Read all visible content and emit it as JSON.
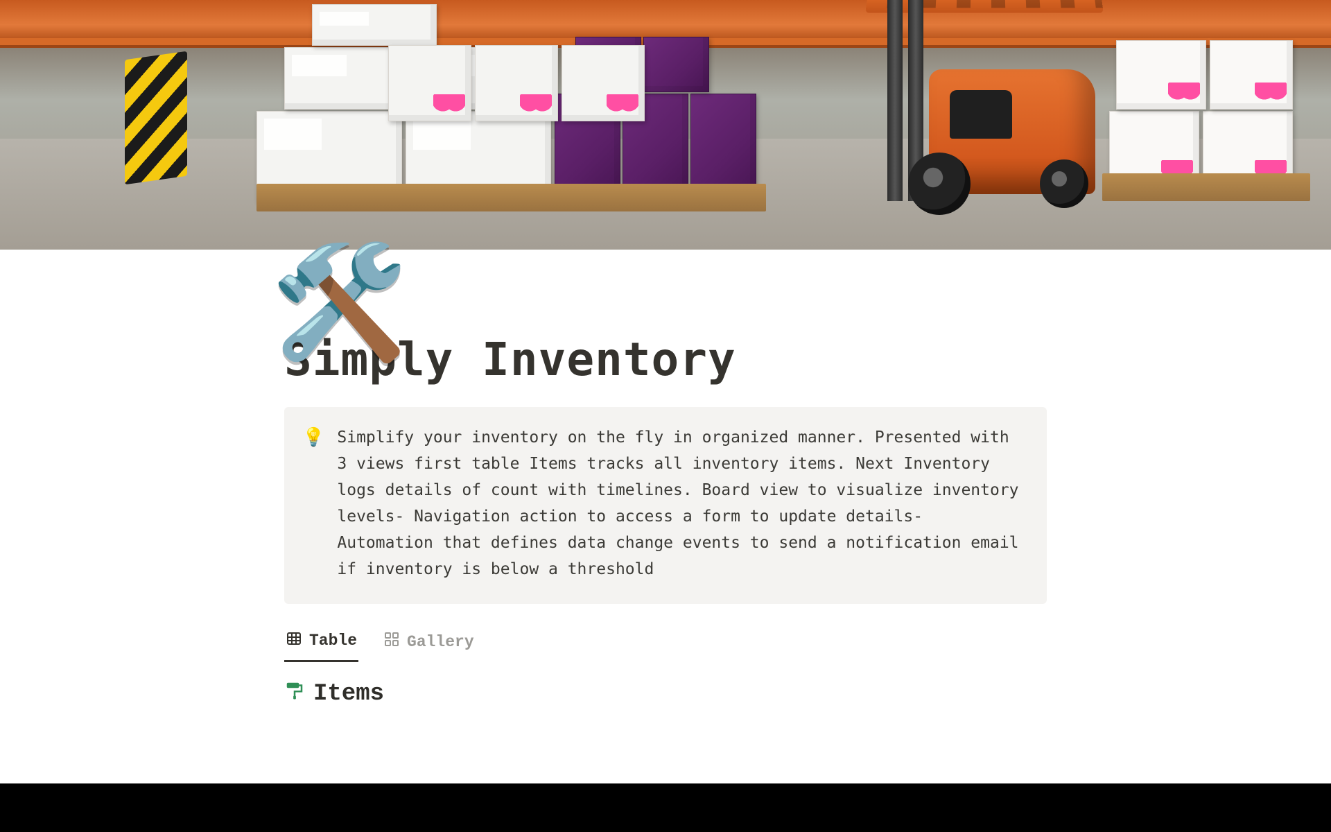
{
  "page": {
    "icon": "🛠️",
    "title": "Simply Inventory"
  },
  "callout": {
    "icon": "💡",
    "text": "Simplify your inventory on the fly in organized manner. Presented with 3 views first table Items tracks all inventory items. Next Inventory logs details of count with timelines. Board  view to visualize inventory levels- Navigation action to access a form to update details- Automation that defines data change events to send a notification email if inventory is below a threshold"
  },
  "tabs": [
    {
      "id": "table",
      "label": "Table",
      "icon": "table-icon",
      "active": true
    },
    {
      "id": "gallery",
      "label": "Gallery",
      "icon": "gallery-icon",
      "active": false
    }
  ],
  "database": {
    "icon": "paint-roller-icon",
    "title": "Items"
  }
}
